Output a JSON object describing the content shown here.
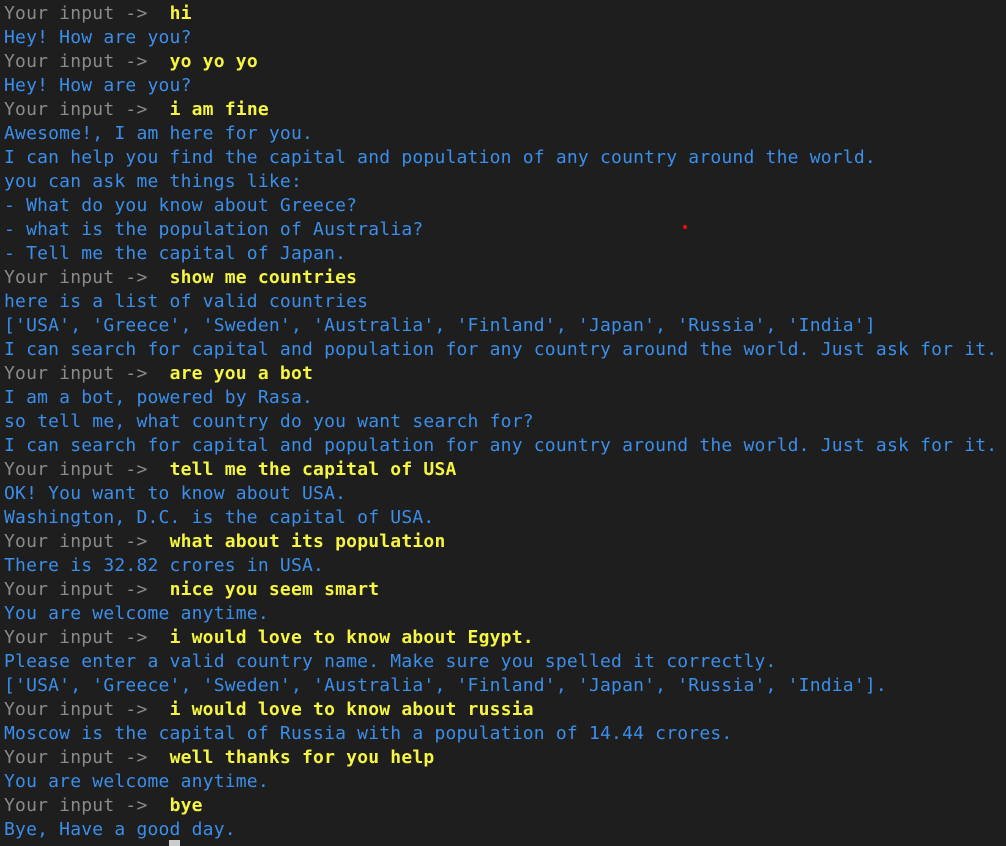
{
  "terminal": {
    "prompt_label": "Your input ->  ",
    "lines": [
      {
        "type": "user",
        "text": "hi"
      },
      {
        "type": "bot",
        "text": "Hey! How are you?"
      },
      {
        "type": "user",
        "text": "yo yo yo"
      },
      {
        "type": "bot",
        "text": "Hey! How are you?"
      },
      {
        "type": "user",
        "text": "i am fine"
      },
      {
        "type": "bot",
        "text": "Awesome!, I am here for you."
      },
      {
        "type": "bot",
        "text": "I can help you find the capital and population of any country around the world."
      },
      {
        "type": "bot",
        "text": "you can ask me things like:"
      },
      {
        "type": "bot",
        "text": "- What do you know about Greece?"
      },
      {
        "type": "bot",
        "text": "- what is the population of Australia?"
      },
      {
        "type": "bot",
        "text": "- Tell me the capital of Japan."
      },
      {
        "type": "user",
        "text": "show me countries"
      },
      {
        "type": "bot",
        "text": "here is a list of valid countries"
      },
      {
        "type": "bot",
        "text": "['USA', 'Greece', 'Sweden', 'Australia', 'Finland', 'Japan', 'Russia', 'India']"
      },
      {
        "type": "bot",
        "text": "I can search for capital and population for any country around the world. Just ask for it."
      },
      {
        "type": "user",
        "text": "are you a bot"
      },
      {
        "type": "bot",
        "text": "I am a bot, powered by Rasa."
      },
      {
        "type": "bot",
        "text": "so tell me, what country do you want search for?"
      },
      {
        "type": "bot",
        "text": "I can search for capital and population for any country around the world. Just ask for it."
      },
      {
        "type": "user",
        "text": "tell me the capital of USA"
      },
      {
        "type": "bot",
        "text": "OK! You want to know about USA."
      },
      {
        "type": "bot",
        "text": "Washington, D.C. is the capital of USA."
      },
      {
        "type": "user",
        "text": "what about its population"
      },
      {
        "type": "bot",
        "text": "There is 32.82 crores in USA."
      },
      {
        "type": "user",
        "text": "nice you seem smart"
      },
      {
        "type": "bot",
        "text": "You are welcome anytime."
      },
      {
        "type": "user",
        "text": "i would love to know about Egypt."
      },
      {
        "type": "bot",
        "text": "Please enter a valid country name. Make sure you spelled it correctly."
      },
      {
        "type": "bot",
        "text": "['USA', 'Greece', 'Sweden', 'Australia', 'Finland', 'Japan', 'Russia', 'India']."
      },
      {
        "type": "user",
        "text": "i would love to know about russia"
      },
      {
        "type": "bot",
        "text": "Moscow is the capital of Russia with a population of 14.44 crores."
      },
      {
        "type": "user",
        "text": "well thanks for you help"
      },
      {
        "type": "bot",
        "text": "You are welcome anytime."
      },
      {
        "type": "user",
        "text": "bye"
      },
      {
        "type": "bot",
        "text": "Bye, Have a good day."
      }
    ]
  },
  "colors": {
    "background": "#1e1e1e",
    "prompt": "#8a8a8a",
    "user_input": "#f5f543",
    "bot_output": "#3b8eea"
  }
}
